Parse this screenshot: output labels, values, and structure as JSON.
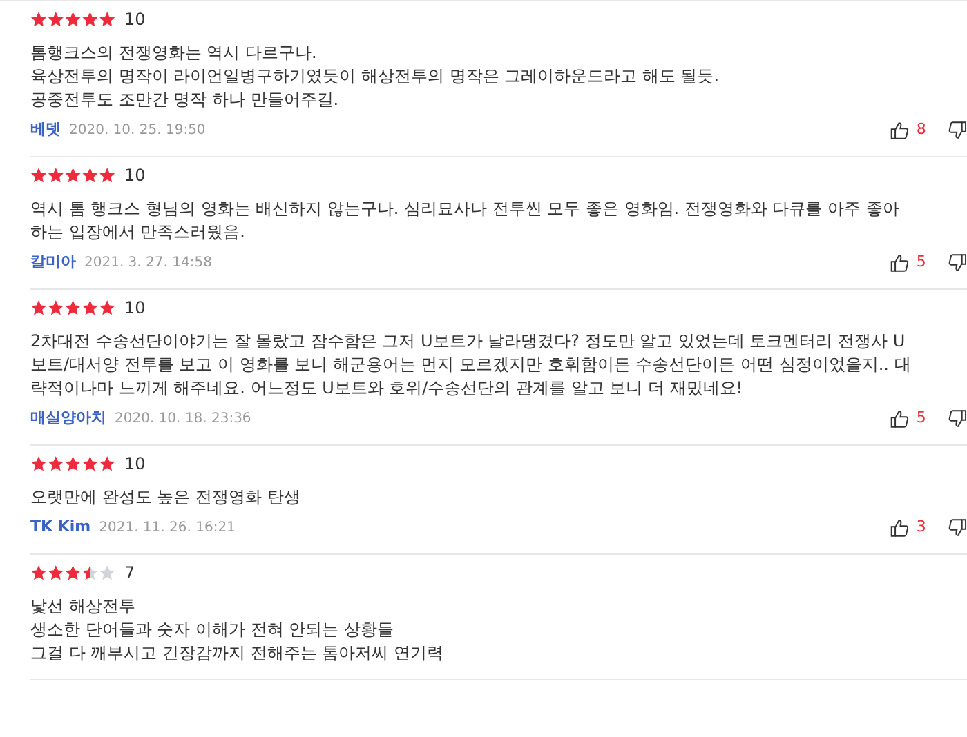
{
  "reviews": [
    {
      "stars": 5,
      "score": "10",
      "lines": [
        "톰행크스의 전쟁영화는 역시 다르구나.",
        "육상전투의 명작이 라이언일병구하기였듯이 해상전투의 명작은 그레이하운드라고 해도 될듯.",
        "공중전투도 조만간 명작 하나 만들어주길."
      ],
      "author": "베뎃",
      "date": "2020. 10. 25. 19:50",
      "likes": "8"
    },
    {
      "stars": 5,
      "score": "10",
      "lines": [
        "역시 톰 행크스 형님의 영화는 배신하지 않는구나. 심리묘사나 전투씬 모두 좋은 영화임. 전쟁영화와 다큐를 아주 좋아하는 입장에서 만족스러웠음."
      ],
      "author": "칼미아",
      "date": "2021. 3. 27. 14:58",
      "likes": "5"
    },
    {
      "stars": 5,
      "score": "10",
      "lines": [
        "2차대전 수송선단이야기는 잘 몰랐고 잠수함은 그저 U보트가 날라댕겼다? 정도만 알고 있었는데 토크멘터리 전쟁사 U보트/대서양 전투를 보고 이 영화를 보니 해군용어는 먼지 모르겠지만 호휘함이든 수송선단이든 어떤 심정이었을지.. 대략적이나마 느끼게 해주네요.  어느정도 U보트와 호위/수송선단의 관계를 알고 보니 더 재밌네요!"
      ],
      "author": "매실양아치",
      "date": "2020. 10. 18. 23:36",
      "likes": "5"
    },
    {
      "stars": 5,
      "score": "10",
      "lines": [
        "오랫만에 완성도 높은 전쟁영화 탄생"
      ],
      "author": "TK Kim",
      "date": "2021. 11. 26. 16:21",
      "likes": "3"
    },
    {
      "stars": 3.5,
      "score": "7",
      "lines": [
        "낯선 해상전투",
        "생소한 단어들과 숫자 이해가 전혀 안되는 상황들",
        "그걸 다 깨부시고 긴장감까지 전해주는 톰아저씨 연기력"
      ]
    }
  ]
}
